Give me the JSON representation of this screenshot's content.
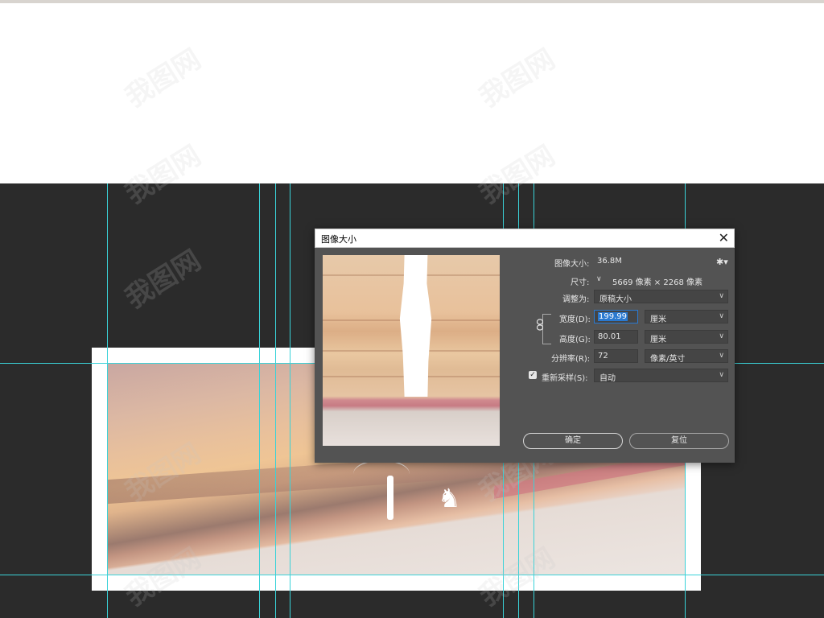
{
  "dialog": {
    "title": "图像大小",
    "image_size_label": "图像大小:",
    "image_size_value": "36.8M",
    "dimensions_label": "尺寸:",
    "dimensions_value": "5669 像素 × 2268 像素",
    "fit_to_label": "调整为:",
    "fit_to_value": "原稿大小",
    "width_label": "宽度(D):",
    "width_value": "199.99",
    "width_unit": "厘米",
    "height_label": "高度(G):",
    "height_value": "80.01",
    "height_unit": "厘米",
    "resolution_label": "分辨率(R):",
    "resolution_value": "72",
    "resolution_unit": "像素/英寸",
    "resample_label": "重新采样(S):",
    "resample_checked": true,
    "resample_value": "自动",
    "ok_label": "确定",
    "reset_label": "复位"
  },
  "watermark": "我图网",
  "colors": {
    "canvas_bg": "#2b2b2b",
    "dialog_bg": "#535353",
    "guide": "#3ad2d8",
    "selection": "#2a79d0"
  }
}
